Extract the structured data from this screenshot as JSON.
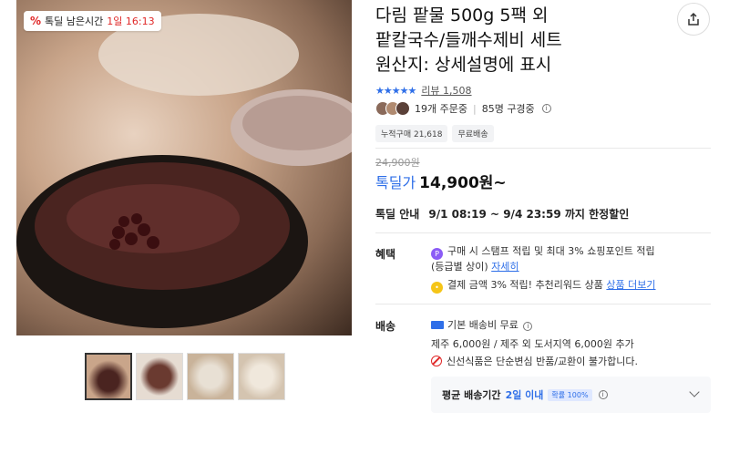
{
  "product": {
    "title_lines": [
      "다림 팥물 500g 5팩 외",
      "팥칼국수/들깨수제비 세트",
      "원산지: 상세설명에 표시"
    ],
    "stars": "★★★★★",
    "review_label": "리뷰 1,508",
    "orders": "19개 주문중",
    "viewers": "85명 구경중",
    "tags": [
      "누적구매 21,618",
      "무료배송"
    ],
    "original_price": "24,900원",
    "deal_label": "톡딜가",
    "price": "14,900원~"
  },
  "timer": {
    "icon": "%",
    "label": "톡딜 남은시간",
    "value": "1일 16:13"
  },
  "deal": {
    "label": "톡딜 안내",
    "period": "9/1 08:19 ~ 9/4 23:59 까지 한정할인"
  },
  "benefit": {
    "label": "혜택",
    "line1": "구매 시 스탬프 적립 및 최대 3% 쇼핑포인트 적립",
    "line1b": "(등급별 상이)",
    "line1_link": "자세히",
    "line2": "결제 금액 3% 적립! 추천리워드 상품",
    "line2_link": "상품 더보기"
  },
  "shipping": {
    "label": "배송",
    "basic": "기본 배송비 무료",
    "extra": "제주 6,000원 / 제주 외 도서지역 6,000원 추가",
    "noreturn": "신선식품은 단순변심 반품/교환이 불가합니다.",
    "avg_label": "평균 배송기간",
    "avg_value": "2일 이내",
    "avg_badge": "확률 100%"
  },
  "colors": {
    "accent": "#2f6fe8",
    "alert": "#e02828"
  },
  "icons": [
    "share-icon",
    "info-icon",
    "truck-icon",
    "no-return-icon",
    "chevron-down-icon",
    "point-icon",
    "coin-icon"
  ]
}
